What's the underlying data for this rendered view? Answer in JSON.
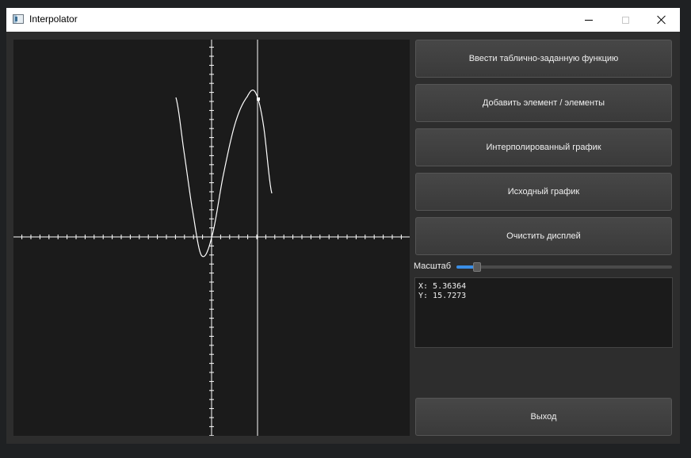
{
  "window": {
    "title": "Interpolator"
  },
  "buttons": {
    "enter_table": "Ввести таблично-заданную функцию",
    "add_elements": "Добавить элемент / элементы",
    "interpolated_graph": "Интерполированный график",
    "original_graph": "Исходный график",
    "clear_display": "Очистить дисплей",
    "exit": "Выход"
  },
  "scale": {
    "label": "Масштаб",
    "value": 0.08
  },
  "coordinates": {
    "x_line": "X: 5.36364",
    "y_line": "Y: 15.7273"
  },
  "colors": {
    "accent": "#3a8ee6",
    "plot_background": "#1b1b1b",
    "curve": "#ffffff"
  },
  "icons": {
    "app": "app-window-icon",
    "minimize": "minimize-icon",
    "maximize": "maximize-icon",
    "close": "close-icon"
  }
}
